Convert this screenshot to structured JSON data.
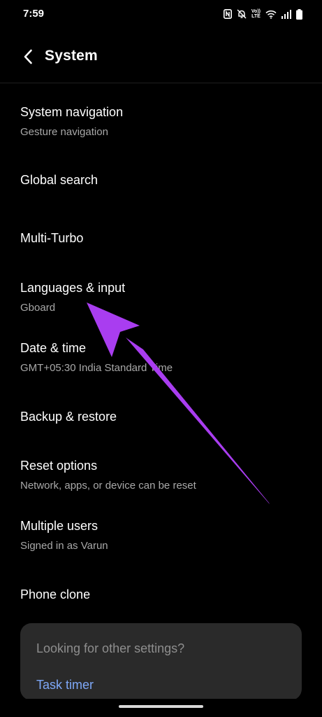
{
  "status_bar": {
    "time": "7:59",
    "volte_top": "Vo))",
    "volte_bottom": "LTE",
    "icons": [
      "nfc-icon",
      "mute-icon",
      "volte-icon",
      "wifi-icon",
      "signal-icon",
      "battery-icon"
    ]
  },
  "header": {
    "back_icon": "back-arrow-icon",
    "title": "System"
  },
  "settings": {
    "items": [
      {
        "title": "System navigation",
        "subtitle": "Gesture navigation"
      },
      {
        "title": "Global search"
      },
      {
        "title": "Multi-Turbo"
      },
      {
        "title": "Languages & input",
        "subtitle": "Gboard"
      },
      {
        "title": "Date & time",
        "subtitle": "GMT+05:30 India Standard Time"
      },
      {
        "title": "Backup & restore"
      },
      {
        "title": "Reset options",
        "subtitle": "Network, apps, or device can be reset"
      },
      {
        "title": "Multiple users",
        "subtitle": "Signed in as Varun"
      },
      {
        "title": "Phone clone"
      }
    ]
  },
  "suggestion_card": {
    "heading": "Looking for other settings?",
    "link": "Task timer"
  },
  "colors": {
    "background": "#000000",
    "text_primary": "#ffffff",
    "text_secondary": "#a8a8a8",
    "card_background": "#2a2a2a",
    "link": "#7ea8f8",
    "annotation_arrow": "#a93df0"
  }
}
